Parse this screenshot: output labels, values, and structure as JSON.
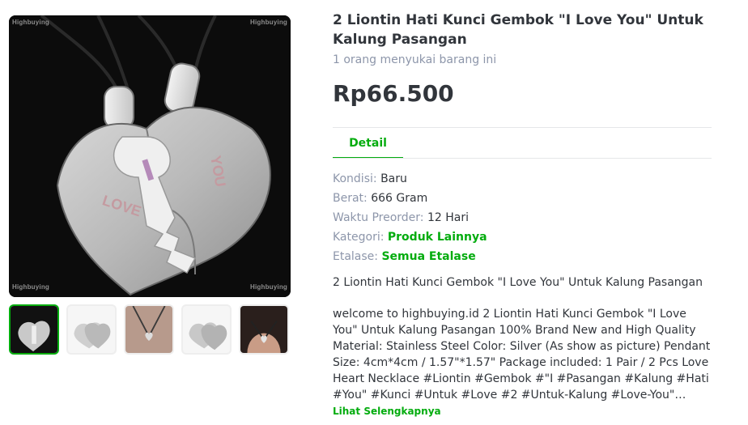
{
  "gallery": {
    "watermark": "Highbuying",
    "main_image": {
      "left_half_text": "LOVE",
      "right_half_text": "YOU"
    },
    "thumbnail_count": 5
  },
  "product": {
    "title": "2 Liontin Hati Kunci Gembok \"I Love You\" Untuk Kalung Pasangan",
    "likes": "1 orang menyukai barang ini",
    "price": "Rp66.500"
  },
  "tabs": {
    "detail": "Detail"
  },
  "info": [
    {
      "label": "Kondisi: ",
      "value": "Baru"
    },
    {
      "label": "Berat: ",
      "value": "666 Gram"
    },
    {
      "label": "Waktu Preorder: ",
      "value": "12 Hari"
    },
    {
      "label": "Kategori: ",
      "value": "Produk Lainnya"
    },
    {
      "label": "Etalase: ",
      "value": "Semua Etalase"
    }
  ],
  "description": {
    "title": "2 Liontin Hati Kunci Gembok \"I Love You\" Untuk Kalung Pasangan",
    "body": "welcome to highbuying.id 2 Liontin Hati Kunci Gembok \"I Love You\" Untuk Kalung Pasangan 100% Brand New and High Quality Material: Stainless Steel Color: Silver (As show as picture) Pendant Size: 4cm*4cm / 1.57\"*1.57\" Package included: 1 Pair / 2 Pcs Love Heart Necklace #Liontin #Gembok #\"I #Pasangan #Kalung #Hati #You\" #Kunci #Untuk #Love #2 #Untuk-Kalung #Love-You\" #Liontin-Hati #Kalung-Pasangan #Pasangan #Kalung #Hati #Kunci",
    "see_more": "Lihat Selengkapnya"
  },
  "colors": {
    "accent": "#03ac0e",
    "text": "#31353b",
    "muted": "#8d96aa"
  }
}
